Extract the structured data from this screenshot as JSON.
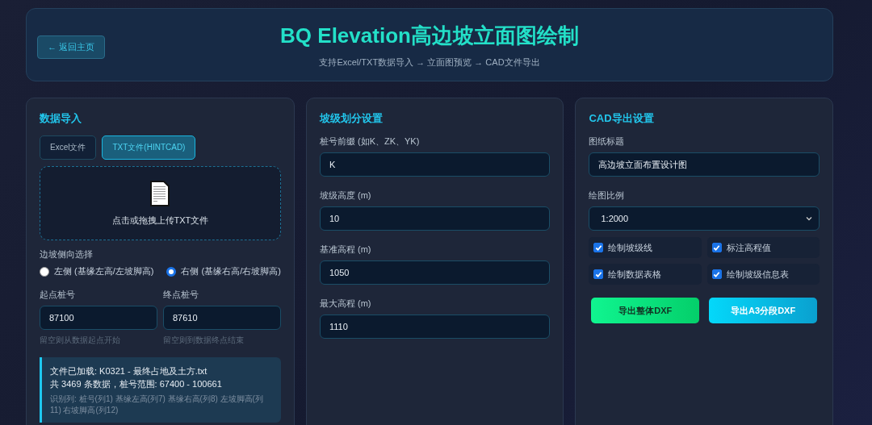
{
  "header": {
    "back_button": "← 返回主页",
    "title": "BQ Elevation高边坡立面图绘制",
    "subtitle": "支持Excel/TXT数据导入 → 立面图预览 → CAD文件导出"
  },
  "data_import": {
    "title": "数据导入",
    "source_tabs": [
      {
        "label": "Excel文件",
        "selected": false
      },
      {
        "label": "TXT文件(HINTCAD)",
        "selected": true
      }
    ],
    "upload": {
      "label": "点击或拖拽上传TXT文件"
    },
    "side_label": "边坡侧向选择",
    "side_options": [
      {
        "label": "左侧 (基缘左高/左坡脚高)",
        "selected": false
      },
      {
        "label": "右侧 (基缘右高/右坡脚高)",
        "selected": true
      }
    ],
    "range_fields": [
      {
        "label": "起点桩号",
        "value": "87100",
        "hint": "留空则从数据起点开始"
      },
      {
        "label": "终点桩号",
        "value": "87610",
        "hint": "留空则到数据终点结束"
      }
    ],
    "file_info": {
      "line_1": "文件已加载: K0321 - 最终占地及土方.txt",
      "line_2": "共 3469 条数据，桩号范围: 67400 - 100661",
      "columns_note": "识别列: 桩号(列1) 基缘左高(列7) 基缘右高(列8) 左坡脚高(列11) 右坡脚高(列12)"
    }
  },
  "slope_settings": {
    "title": "坡级划分设置",
    "fields": [
      {
        "label": "桩号前缀 (如K、ZK、YK)",
        "value": "K"
      },
      {
        "label": "坡级高度 (m)",
        "value": "10"
      },
      {
        "label": "基准高程 (m)",
        "value": "1050"
      },
      {
        "label": "最大高程 (m)",
        "value": "1110"
      }
    ]
  },
  "cad_export": {
    "title": "CAD导出设置",
    "fields": [
      {
        "kind": "text",
        "label": "图纸标题",
        "value": "高边坡立面布置设计图"
      },
      {
        "kind": "select",
        "label": "绘图比例",
        "value": "1:2000"
      }
    ],
    "options": [
      {
        "label": "绘制坡级线",
        "checked": true
      },
      {
        "label": "标注高程值",
        "checked": true
      },
      {
        "label": "绘制数据表格",
        "checked": true
      },
      {
        "label": "绘制坡级信息表",
        "checked": true
      }
    ],
    "buttons": [
      {
        "label": "导出整体DXF",
        "kind": "green"
      },
      {
        "label": "导出A3分段DXF",
        "kind": "blue"
      }
    ]
  }
}
